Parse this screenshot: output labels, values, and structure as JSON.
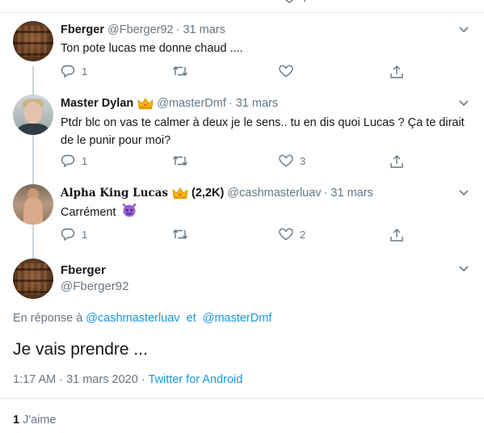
{
  "thread": {
    "replies": [
      {
        "name": "Fberger",
        "handle": "@Fberger92",
        "date": "31 mars",
        "text": "Ton pote lucas me donne chaud ....",
        "reply_count": "1",
        "retweet_count": "",
        "like_count": "",
        "avatar": "bookshelf-avatar"
      },
      {
        "name": "Master Dylan",
        "badge": "crown-emoji",
        "handle": "@masterDmf",
        "date": "31 mars",
        "text": "Ptdr blc on vas te calmer à deux je le sens.. tu en dis quoi Lucas ? Ça te dirait de le punir pour moi?",
        "reply_count": "1",
        "retweet_count": "",
        "like_count": "3",
        "avatar": "boy-portrait-avatar"
      },
      {
        "name": "Alpha King Lucas",
        "badge": "crown-emoji",
        "followers": "(2,2K)",
        "handle": "@cashmasterluav",
        "date": "31 mars",
        "text": "Carrément",
        "emoji": "smiling-imp-emoji",
        "reply_count": "1",
        "retweet_count": "",
        "like_count": "2",
        "avatar": "shirtless-portrait-avatar"
      }
    ]
  },
  "main_tweet": {
    "name": "Fberger",
    "handle": "@Fberger92",
    "reply_to_prefix": "En réponse à",
    "reply_to_user1": "@cashmasterluav",
    "reply_to_sep": "et",
    "reply_to_user2": "@masterDmf",
    "text": "Je vais prendre ...",
    "time": "1:17 AM",
    "date_sep": "·",
    "date": "31 mars 2020",
    "source": "Twitter for Android",
    "likes_count": "1",
    "likes_label": "J'aime"
  },
  "colors": {
    "text": "#14171a",
    "muted": "#657786",
    "link": "#1b95e0",
    "border": "#e6ecf0",
    "thread_line": "#ccd6dd"
  }
}
